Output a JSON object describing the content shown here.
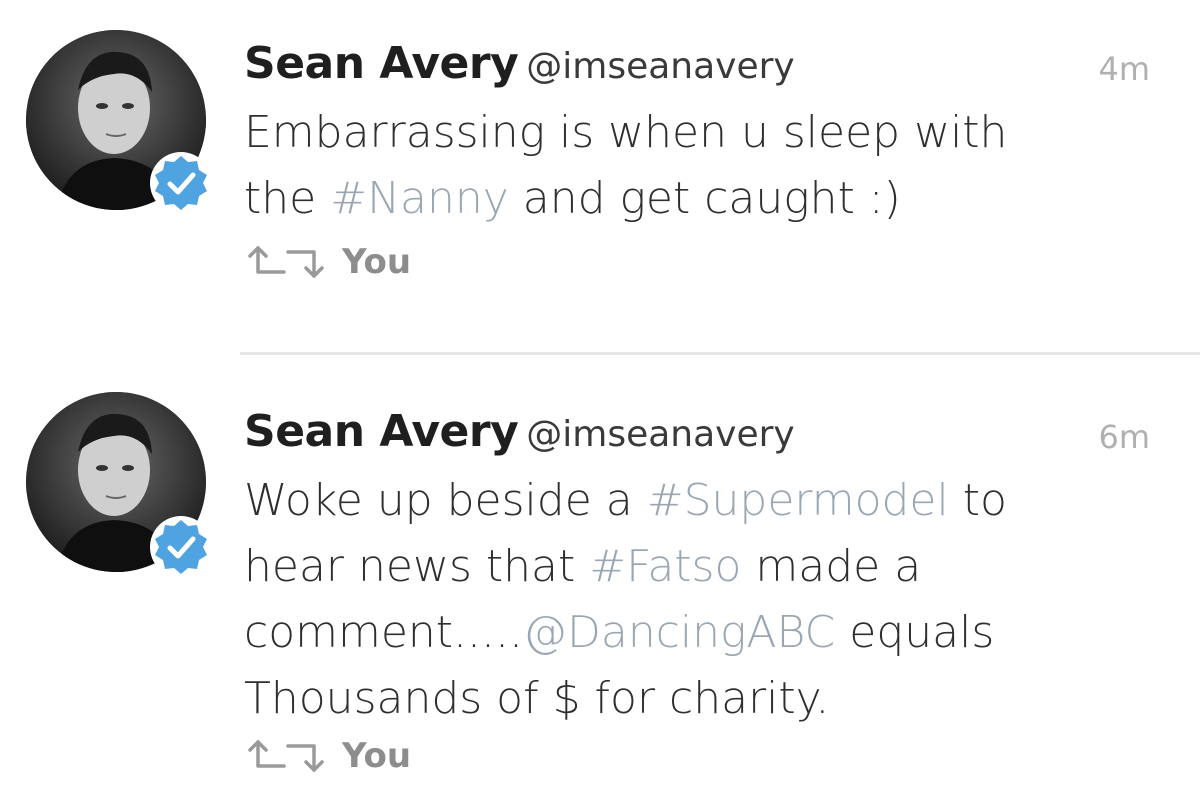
{
  "tweets": [
    {
      "name": "Sean Avery",
      "handle": "@imseanavery",
      "time": "4m",
      "text_parts": {
        "p1": "Embarrassing is when u sleep with",
        "p2": "the ",
        "h1": "#Nanny",
        "p3": " and get caught :)"
      },
      "retweeted_by": "You"
    },
    {
      "name": "Sean Avery",
      "handle": "@imseanavery",
      "time": "6m",
      "text_parts": {
        "p1": "Woke up beside a ",
        "h1": "#Supermodel",
        "p2": " to",
        "p3": "hear news that ",
        "h2": "#Fatso",
        "p4": " made a",
        "p5": "comment.....",
        "m1": "@DancingABC",
        "p6": " equals",
        "p7": "Thousands of $ for charity."
      },
      "retweeted_by": "You"
    }
  ],
  "icons": {
    "verified": "verified-badge-icon",
    "retweet": "retweet-icon"
  },
  "colors": {
    "hashtag": "#9aa7b3",
    "verified": "#4fa3e0",
    "muted": "#8d8d8d",
    "timestamp": "#b0b0b0"
  }
}
